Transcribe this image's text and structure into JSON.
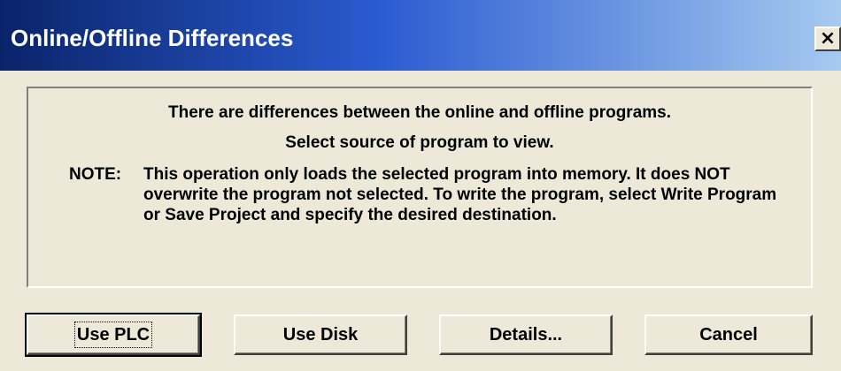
{
  "window": {
    "title": "Online/Offline Differences",
    "close_icon_glyph": "×",
    "colors": {
      "title_gradient_start": "#0a246a",
      "title_gradient_end": "#a6caf0",
      "title_text": "#ffffff",
      "face": "#ece9d8"
    }
  },
  "message": {
    "line1": "There are differences between the online and offline programs.",
    "line2": "Select source of program to view.",
    "note_label": "NOTE:",
    "note_text": "This operation only loads the selected program into memory. It does NOT overwrite the program not selected. To write the program, select Write Program or Save Project and specify the desired destination."
  },
  "buttons": {
    "use_plc": "Use PLC",
    "use_disk": "Use Disk",
    "details": "Details...",
    "cancel": "Cancel"
  }
}
